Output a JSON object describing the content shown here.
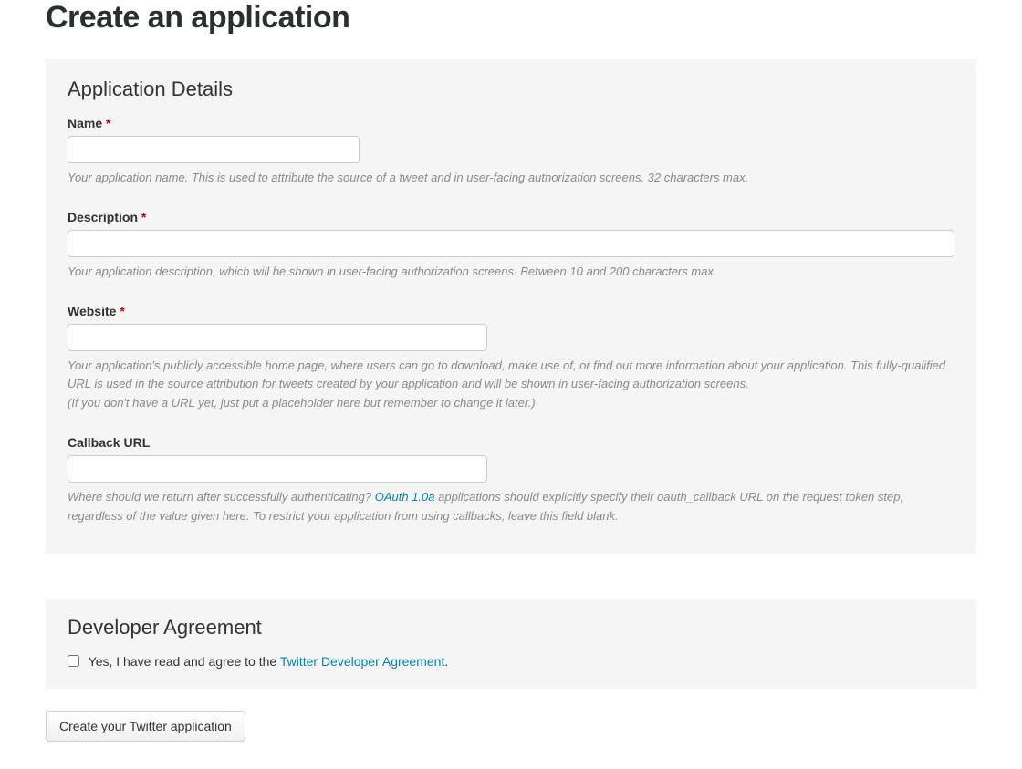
{
  "page_title": "Create an application",
  "section_details": {
    "heading": "Application Details",
    "fields": {
      "name": {
        "label": "Name",
        "required": "*",
        "help": "Your application name. This is used to attribute the source of a tweet and in user-facing authorization screens. 32 characters max."
      },
      "description": {
        "label": "Description",
        "required": "*",
        "help": "Your application description, which will be shown in user-facing authorization screens. Between 10 and 200 characters max."
      },
      "website": {
        "label": "Website",
        "required": "*",
        "help_line1": "Your application's publicly accessible home page, where users can go to download, make use of, or find out more information about your application. This fully-qualified URL is used in the source attribution for tweets created by your application and will be shown in user-facing authorization screens.",
        "help_line2": "(If you don't have a URL yet, just put a placeholder here but remember to change it later.)"
      },
      "callback": {
        "label": "Callback URL",
        "help_before": "Where should we return after successfully authenticating? ",
        "help_link": "OAuth 1.0a",
        "help_after": " applications should explicitly specify their oauth_callback URL on the request token step, regardless of the value given here. To restrict your application from using callbacks, leave this field blank."
      }
    }
  },
  "section_agreement": {
    "heading": "Developer Agreement",
    "checkbox_text_before": "Yes, I have read and agree to the ",
    "checkbox_link": "Twitter Developer Agreement",
    "checkbox_text_after": "."
  },
  "submit_button": "Create your Twitter application"
}
